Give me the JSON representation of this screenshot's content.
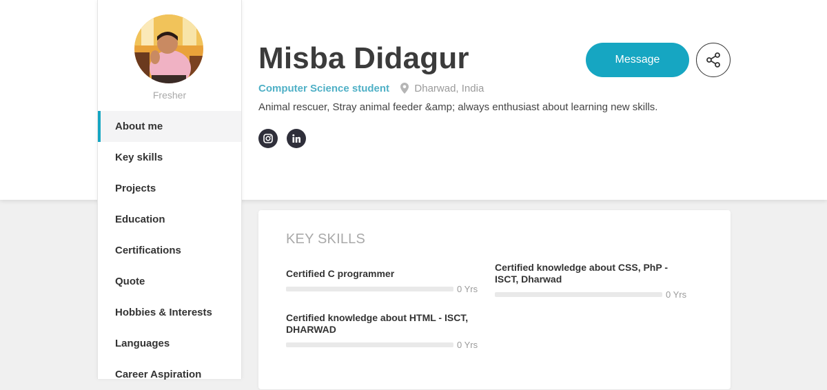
{
  "profile": {
    "name": "Misba Didagur",
    "level": "Fresher",
    "headline": "Computer Science student",
    "location": "Dharwad, India",
    "bio": "Animal rescuer, Stray animal feeder &amp; always enthusiast about learning new skills."
  },
  "social": [
    {
      "network": "instagram",
      "icon": "instagram-icon"
    },
    {
      "network": "linkedin",
      "icon": "linkedin-icon"
    }
  ],
  "actions": {
    "message_label": "Message",
    "share_icon": "share-icon"
  },
  "sidebar": {
    "active_index": 0,
    "items": [
      {
        "label": "About me"
      },
      {
        "label": "Key skills"
      },
      {
        "label": "Projects"
      },
      {
        "label": "Education"
      },
      {
        "label": "Certifications"
      },
      {
        "label": "Quote"
      },
      {
        "label": "Hobbies & Interests"
      },
      {
        "label": "Languages"
      },
      {
        "label": "Career Aspiration"
      }
    ]
  },
  "key_skills": {
    "title": "KEY SKILLS",
    "items": [
      {
        "name": "Certified C programmer",
        "experience": "0 Yrs",
        "level": 0
      },
      {
        "name": "Certified knowledge about CSS, PhP - ISCT, Dharwad",
        "experience": "0 Yrs",
        "level": 0
      },
      {
        "name": "Certified knowledge about HTML - ISCT, DHARWAD",
        "experience": "0 Yrs",
        "level": 0
      }
    ]
  },
  "colors": {
    "accent": "#16a6c2",
    "headline": "#4fb0c6",
    "social_bg": "#2f2f3a"
  }
}
